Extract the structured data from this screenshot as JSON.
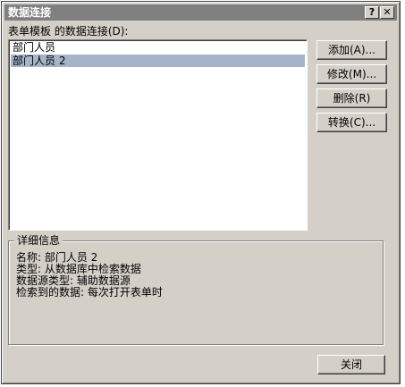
{
  "window": {
    "title": "数据连接",
    "help_label": "?",
    "close_label": "✕"
  },
  "list": {
    "label": "表单模板 的数据连接(D):",
    "items": [
      "部门人员",
      "部门人员 2"
    ],
    "selected_index": 1
  },
  "buttons": {
    "add": "添加(A)...",
    "modify": "修改(M)...",
    "delete": "删除(R)",
    "convert": "转换(C)...",
    "close": "关闭"
  },
  "details": {
    "title": "详细信息",
    "lines": [
      "名称: 部门人员 2",
      "类型: 从数据库中检索数据",
      "数据源类型: 辅助数据源",
      "检索到的数据: 每次打开表单时"
    ]
  },
  "colors": {
    "dialog_bg": "#d4d0c8",
    "titlebar_bg": "#808080",
    "selection_bg": "#a6b4c9"
  }
}
